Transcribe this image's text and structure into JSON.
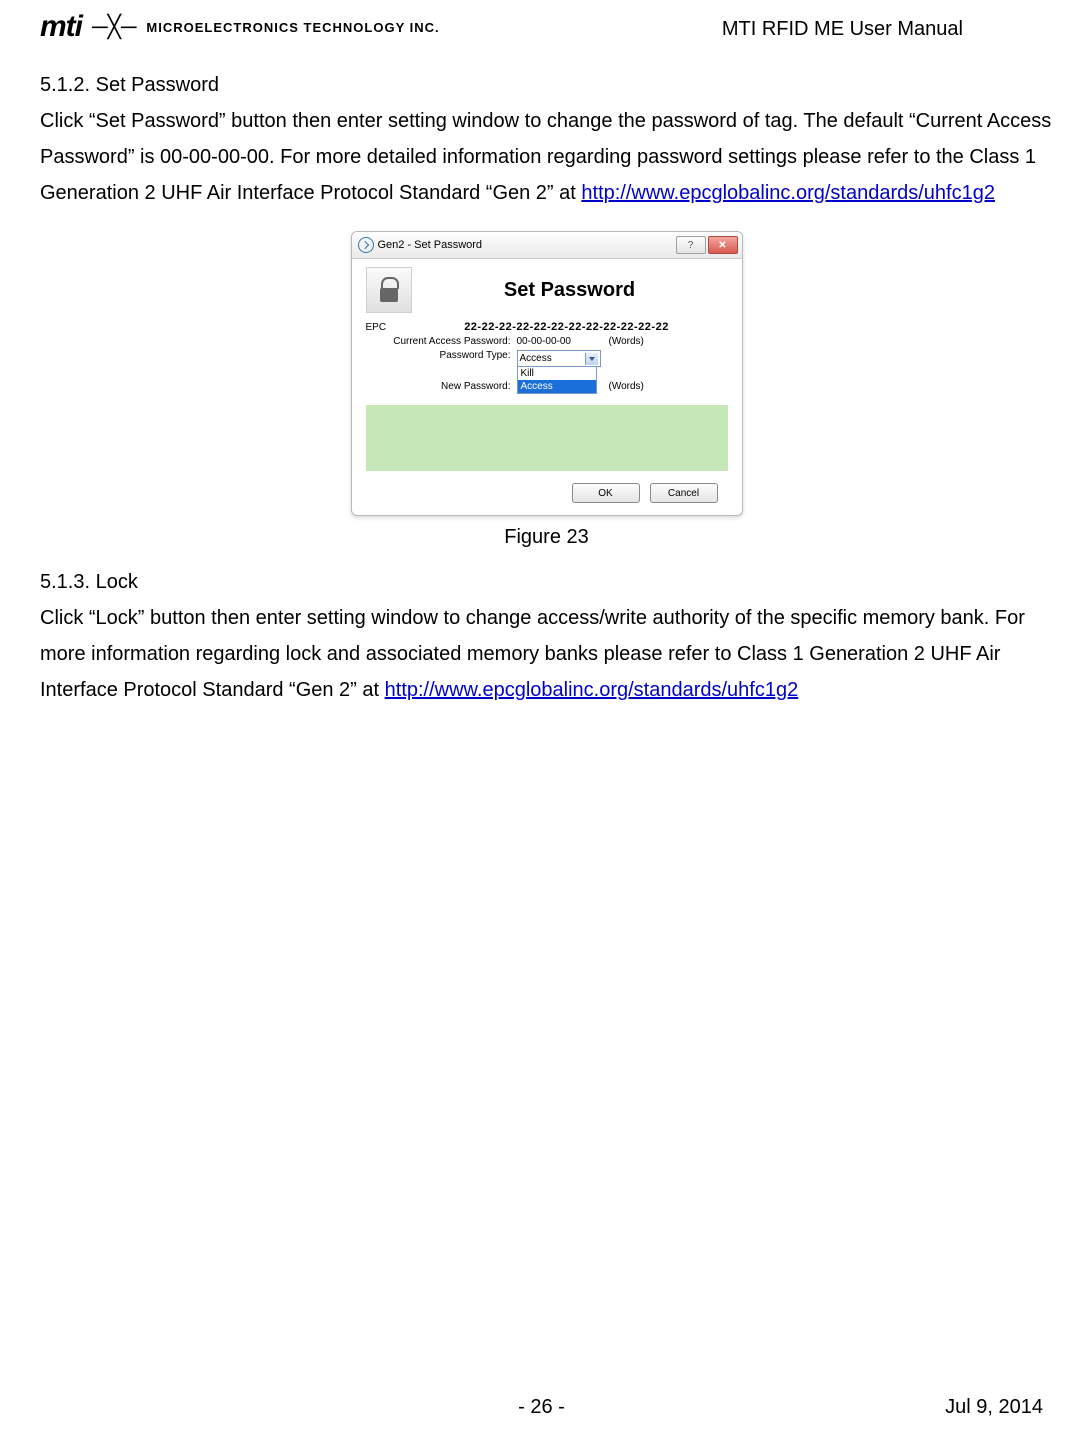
{
  "header": {
    "brand_main": "mti",
    "brand_sub": "MICROELECTRONICS TECHNOLOGY INC.",
    "doc_title": "MTI RFID ME User Manual"
  },
  "s1": {
    "num": "5.1.2. ",
    "title": "Set Password",
    "body_a": "Click “Set Password” button then enter setting window to change the password of tag. The default “Current Access Password” is 00-00-00-00. For more detailed information regarding password settings please refer to the Class 1 Generation 2 UHF Air Interface Protocol Standard “Gen 2” at ",
    "link": "http://www.epcglobalinc.org/standards/uhfc1g2"
  },
  "dialog": {
    "window_title": "Gen2 - Set Password",
    "help_symbol": "?",
    "close_symbol": "✕",
    "title": "Set Password",
    "epc_label": "EPC",
    "epc_value": "22-22-22-22-22-22-22-22-22-22-22-22",
    "cap_label": "Current Access Password:",
    "cap_value": "00-00-00-00",
    "cap_unit": "(Words)",
    "ptype_label": "Password Type:",
    "ptype_value": "Access",
    "npw_label": "New Password:",
    "npw_unit": "(Words)",
    "dd_kill": "Kill",
    "dd_access": "Access",
    "ok": "OK",
    "cancel": "Cancel"
  },
  "figure1_caption": "Figure 23",
  "s2": {
    "num": "5.1.3. ",
    "title": "Lock",
    "body_a": "Click “Lock” button then enter setting window to change access/write authority of the specific memory bank. For more information regarding lock and associated memory banks please refer to Class 1 Generation 2 UHF Air Interface Protocol Standard “Gen 2” at ",
    "link": "http://www.epcglobalinc.org/standards/uhfc1g2"
  },
  "footer": {
    "page": "-  26  -",
    "date": "Jul  9,  2014"
  }
}
